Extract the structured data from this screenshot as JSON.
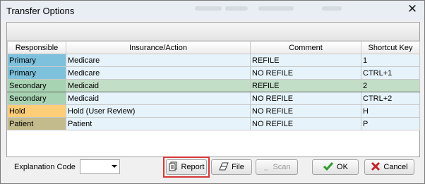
{
  "window": {
    "title": "Transfer Options",
    "close_glyph": "✕"
  },
  "grid": {
    "columns": [
      "Responsible",
      "Insurance/Action",
      "Comment",
      "Shortcut Key"
    ],
    "rows": [
      {
        "responsible": "Primary",
        "insurance": "Medicare",
        "comment": "REFILE",
        "shortcut": "1",
        "resp_color": "#7dc1dc"
      },
      {
        "responsible": "Primary",
        "insurance": "Medicare",
        "comment": "NO REFILE",
        "shortcut": "CTRL+1",
        "resp_color": "#7dc1dc"
      },
      {
        "responsible": "Secondary",
        "insurance": "Medicaid",
        "comment": "REFILE",
        "shortcut": "2",
        "resp_color": "#a8d3b3",
        "selected": true
      },
      {
        "responsible": "Secondary",
        "insurance": "Medicaid",
        "comment": "NO REFILE",
        "shortcut": "CTRL+2",
        "resp_color": "#a8d3b3"
      },
      {
        "responsible": "Hold",
        "insurance": "Hold (User Review)",
        "comment": "NO REFILE",
        "shortcut": "H",
        "resp_color": "#fdcd78"
      },
      {
        "responsible": "Patient",
        "insurance": "Patient",
        "comment": "NO REFILE",
        "shortcut": "P",
        "resp_color": "#c4bb8c"
      }
    ]
  },
  "footer": {
    "explanation_label": "Explanation Code",
    "explanation_value": "",
    "buttons": {
      "report": {
        "label": "Report",
        "icon": "document-icon"
      },
      "file": {
        "label": "File",
        "icon": "eraser-icon"
      },
      "scan": {
        "label": "Scan",
        "icon": "scan-icon",
        "disabled": true
      },
      "ok": {
        "label": "OK",
        "icon": "checkmark-icon"
      },
      "cancel": {
        "label": "Cancel",
        "icon": "x-icon"
      }
    }
  },
  "colors": {
    "accent_highlight": "#d43838",
    "row_bg": "#e6f3fb",
    "selected_row_bg": "#c3dec6"
  }
}
